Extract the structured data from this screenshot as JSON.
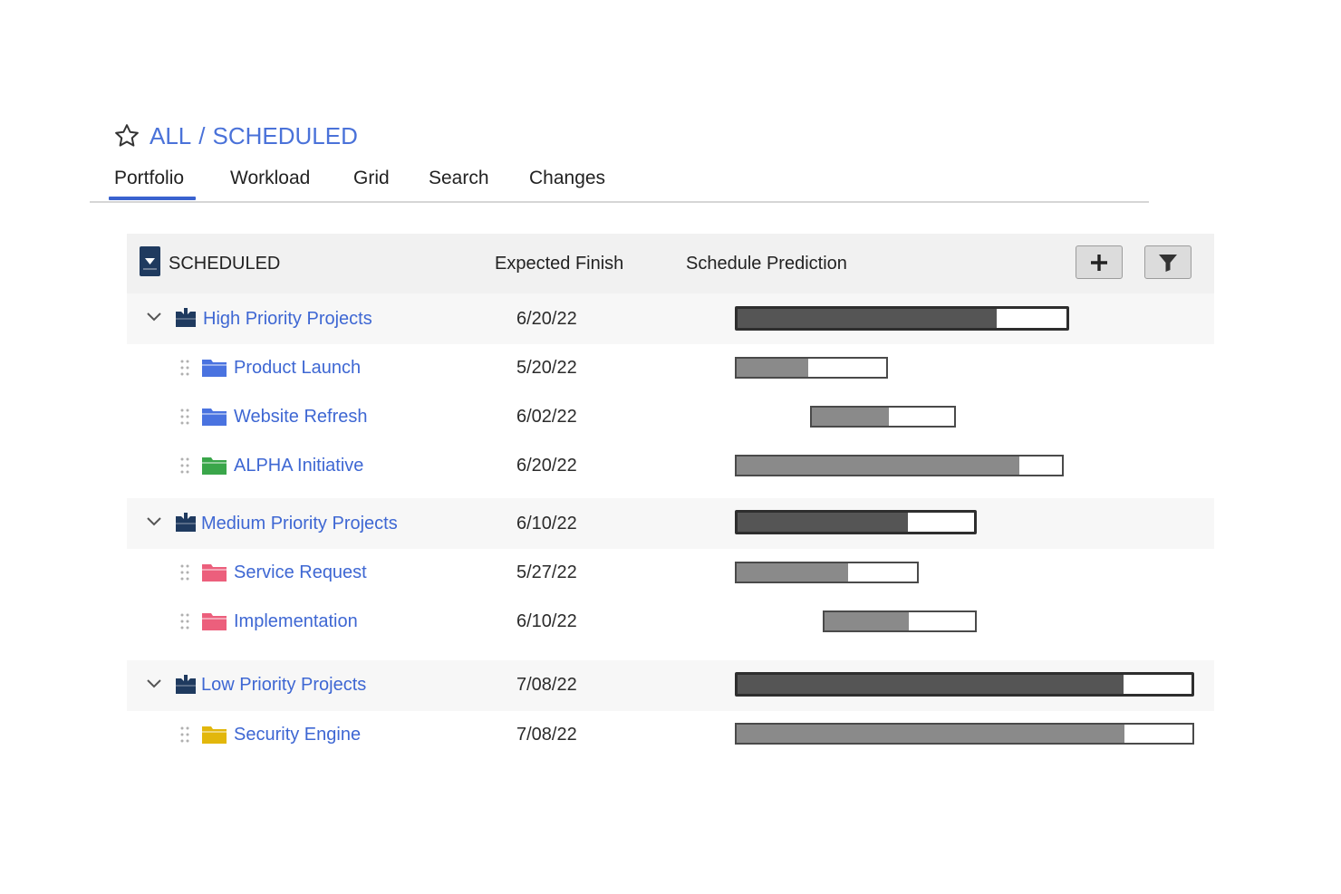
{
  "breadcrumb": {
    "all": "ALL",
    "separator": "/",
    "current": "SCHEDULED"
  },
  "tabs": [
    {
      "label": "Portfolio",
      "active": true
    },
    {
      "label": "Workload",
      "active": false
    },
    {
      "label": "Grid",
      "active": false
    },
    {
      "label": "Search",
      "active": false
    },
    {
      "label": "Changes",
      "active": false
    }
  ],
  "table": {
    "title": "SCHEDULED",
    "col_finish": "Expected Finish",
    "col_prediction": "Schedule Prediction",
    "add_icon": "plus-icon",
    "filter_icon": "filter-icon"
  },
  "groups": [
    {
      "name": "High Priority Projects",
      "finish": "6/20/22",
      "bar": {
        "start": 0.0,
        "end": 0.727,
        "progress": 0.79
      },
      "projects": [
        {
          "name": "Product Launch",
          "finish": "5/20/22",
          "color": "#4a73e0",
          "bar": {
            "start": 0.0,
            "end": 0.334,
            "progress": 0.48
          }
        },
        {
          "name": "Website Refresh",
          "finish": "6/02/22",
          "color": "#4a73e0",
          "bar": {
            "start": 0.164,
            "end": 0.482,
            "progress": 0.54
          }
        },
        {
          "name": "ALPHA Initiative",
          "finish": "6/20/22",
          "color": "#3aa64a",
          "bar": {
            "start": 0.0,
            "end": 0.716,
            "progress": 0.87
          }
        }
      ]
    },
    {
      "name": "Medium Priority Projects",
      "finish": "6/10/22",
      "bar": {
        "start": 0.0,
        "end": 0.526,
        "progress": 0.72
      },
      "projects": [
        {
          "name": "Service Request",
          "finish": "5/27/22",
          "color": "#ec5f7c",
          "bar": {
            "start": 0.0,
            "end": 0.4,
            "progress": 0.62
          }
        },
        {
          "name": "Implementation",
          "finish": "6/10/22",
          "color": "#ec5f7c",
          "bar": {
            "start": 0.192,
            "end": 0.526,
            "progress": 0.56
          }
        }
      ]
    },
    {
      "name": "Low Priority Projects",
      "finish": "7/08/22",
      "bar": {
        "start": 0.0,
        "end": 1.0,
        "progress": 0.85
      },
      "projects": [
        {
          "name": "Security Engine",
          "finish": "7/08/22",
          "color": "#e2b70c",
          "bar": {
            "start": 0.0,
            "end": 1.0,
            "progress": 0.85
          }
        }
      ]
    }
  ]
}
